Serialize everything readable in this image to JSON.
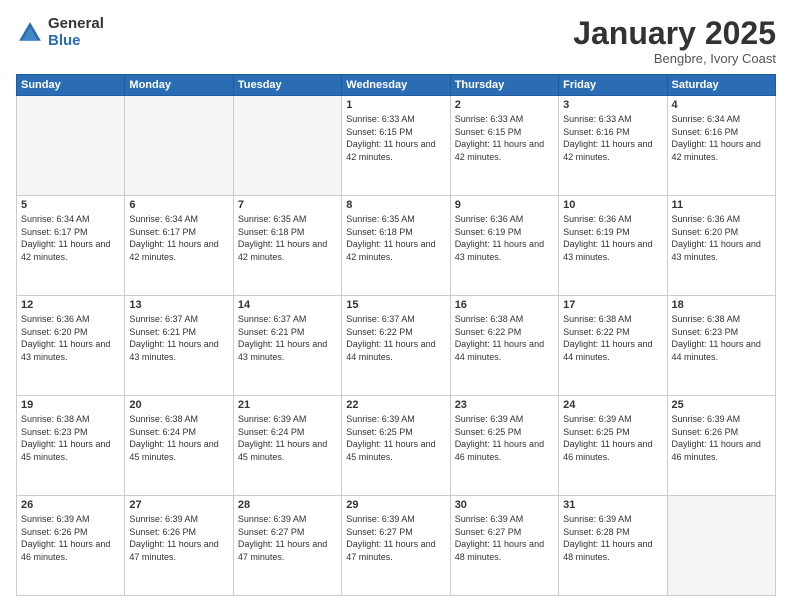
{
  "header": {
    "logo_general": "General",
    "logo_blue": "Blue",
    "month_title": "January 2025",
    "location": "Bengbre, Ivory Coast"
  },
  "weekdays": [
    "Sunday",
    "Monday",
    "Tuesday",
    "Wednesday",
    "Thursday",
    "Friday",
    "Saturday"
  ],
  "weeks": [
    [
      {
        "day": "",
        "info": ""
      },
      {
        "day": "",
        "info": ""
      },
      {
        "day": "",
        "info": ""
      },
      {
        "day": "1",
        "info": "Sunrise: 6:33 AM\nSunset: 6:15 PM\nDaylight: 11 hours\nand 42 minutes."
      },
      {
        "day": "2",
        "info": "Sunrise: 6:33 AM\nSunset: 6:15 PM\nDaylight: 11 hours\nand 42 minutes."
      },
      {
        "day": "3",
        "info": "Sunrise: 6:33 AM\nSunset: 6:16 PM\nDaylight: 11 hours\nand 42 minutes."
      },
      {
        "day": "4",
        "info": "Sunrise: 6:34 AM\nSunset: 6:16 PM\nDaylight: 11 hours\nand 42 minutes."
      }
    ],
    [
      {
        "day": "5",
        "info": "Sunrise: 6:34 AM\nSunset: 6:17 PM\nDaylight: 11 hours\nand 42 minutes."
      },
      {
        "day": "6",
        "info": "Sunrise: 6:34 AM\nSunset: 6:17 PM\nDaylight: 11 hours\nand 42 minutes."
      },
      {
        "day": "7",
        "info": "Sunrise: 6:35 AM\nSunset: 6:18 PM\nDaylight: 11 hours\nand 42 minutes."
      },
      {
        "day": "8",
        "info": "Sunrise: 6:35 AM\nSunset: 6:18 PM\nDaylight: 11 hours\nand 42 minutes."
      },
      {
        "day": "9",
        "info": "Sunrise: 6:36 AM\nSunset: 6:19 PM\nDaylight: 11 hours\nand 43 minutes."
      },
      {
        "day": "10",
        "info": "Sunrise: 6:36 AM\nSunset: 6:19 PM\nDaylight: 11 hours\nand 43 minutes."
      },
      {
        "day": "11",
        "info": "Sunrise: 6:36 AM\nSunset: 6:20 PM\nDaylight: 11 hours\nand 43 minutes."
      }
    ],
    [
      {
        "day": "12",
        "info": "Sunrise: 6:36 AM\nSunset: 6:20 PM\nDaylight: 11 hours\nand 43 minutes."
      },
      {
        "day": "13",
        "info": "Sunrise: 6:37 AM\nSunset: 6:21 PM\nDaylight: 11 hours\nand 43 minutes."
      },
      {
        "day": "14",
        "info": "Sunrise: 6:37 AM\nSunset: 6:21 PM\nDaylight: 11 hours\nand 43 minutes."
      },
      {
        "day": "15",
        "info": "Sunrise: 6:37 AM\nSunset: 6:22 PM\nDaylight: 11 hours\nand 44 minutes."
      },
      {
        "day": "16",
        "info": "Sunrise: 6:38 AM\nSunset: 6:22 PM\nDaylight: 11 hours\nand 44 minutes."
      },
      {
        "day": "17",
        "info": "Sunrise: 6:38 AM\nSunset: 6:22 PM\nDaylight: 11 hours\nand 44 minutes."
      },
      {
        "day": "18",
        "info": "Sunrise: 6:38 AM\nSunset: 6:23 PM\nDaylight: 11 hours\nand 44 minutes."
      }
    ],
    [
      {
        "day": "19",
        "info": "Sunrise: 6:38 AM\nSunset: 6:23 PM\nDaylight: 11 hours\nand 45 minutes."
      },
      {
        "day": "20",
        "info": "Sunrise: 6:38 AM\nSunset: 6:24 PM\nDaylight: 11 hours\nand 45 minutes."
      },
      {
        "day": "21",
        "info": "Sunrise: 6:39 AM\nSunset: 6:24 PM\nDaylight: 11 hours\nand 45 minutes."
      },
      {
        "day": "22",
        "info": "Sunrise: 6:39 AM\nSunset: 6:25 PM\nDaylight: 11 hours\nand 45 minutes."
      },
      {
        "day": "23",
        "info": "Sunrise: 6:39 AM\nSunset: 6:25 PM\nDaylight: 11 hours\nand 46 minutes."
      },
      {
        "day": "24",
        "info": "Sunrise: 6:39 AM\nSunset: 6:25 PM\nDaylight: 11 hours\nand 46 minutes."
      },
      {
        "day": "25",
        "info": "Sunrise: 6:39 AM\nSunset: 6:26 PM\nDaylight: 11 hours\nand 46 minutes."
      }
    ],
    [
      {
        "day": "26",
        "info": "Sunrise: 6:39 AM\nSunset: 6:26 PM\nDaylight: 11 hours\nand 46 minutes."
      },
      {
        "day": "27",
        "info": "Sunrise: 6:39 AM\nSunset: 6:26 PM\nDaylight: 11 hours\nand 47 minutes."
      },
      {
        "day": "28",
        "info": "Sunrise: 6:39 AM\nSunset: 6:27 PM\nDaylight: 11 hours\nand 47 minutes."
      },
      {
        "day": "29",
        "info": "Sunrise: 6:39 AM\nSunset: 6:27 PM\nDaylight: 11 hours\nand 47 minutes."
      },
      {
        "day": "30",
        "info": "Sunrise: 6:39 AM\nSunset: 6:27 PM\nDaylight: 11 hours\nand 48 minutes."
      },
      {
        "day": "31",
        "info": "Sunrise: 6:39 AM\nSunset: 6:28 PM\nDaylight: 11 hours\nand 48 minutes."
      },
      {
        "day": "",
        "info": ""
      }
    ]
  ]
}
